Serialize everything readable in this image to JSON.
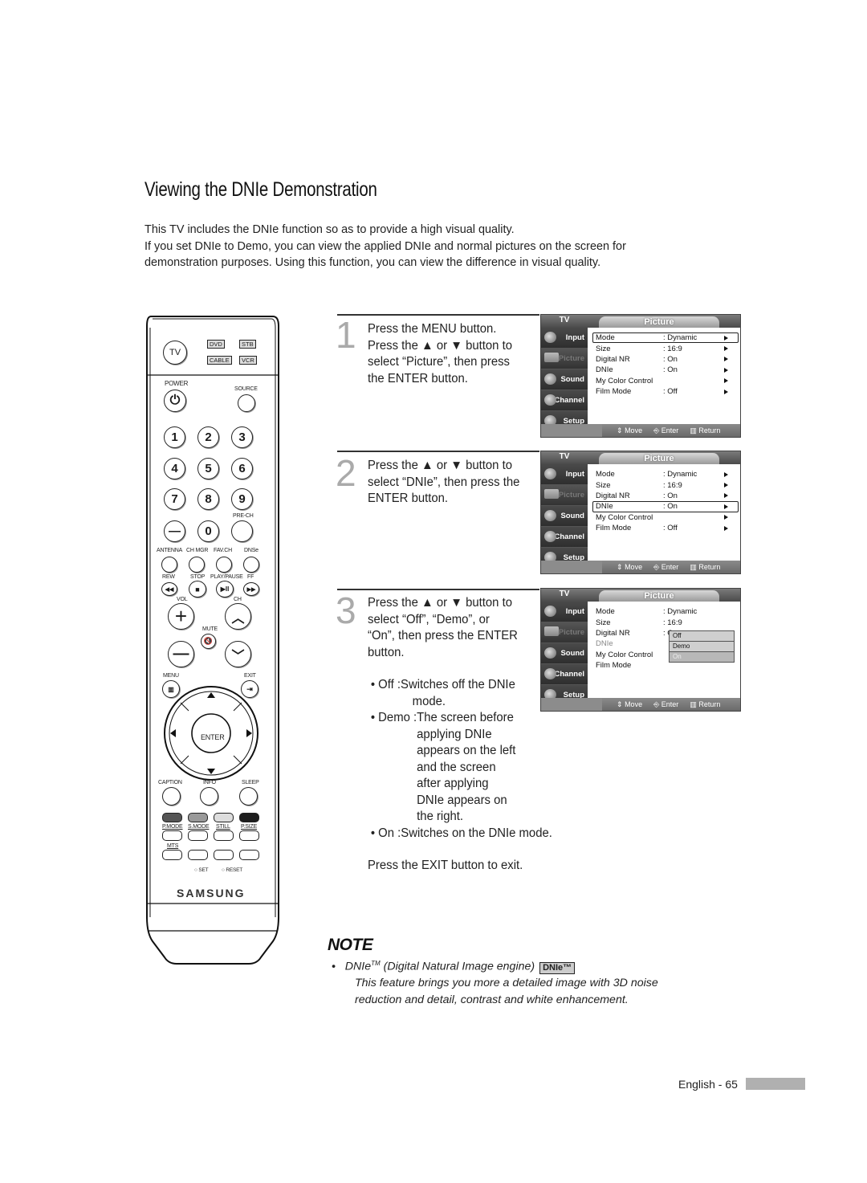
{
  "page": {
    "title": "Viewing the DNIe Demonstration",
    "intro": [
      "This TV includes the DNIe function so as to provide a high visual quality.",
      "If you set DNIe to Demo, you can view the applied DNIe and normal pictures on the screen for",
      "demonstration purposes. Using this function, you can view the difference in visual quality."
    ]
  },
  "steps": [
    {
      "number": "1",
      "lines": [
        "Press the MENU button.",
        "Press the ▲ or ▼ button to",
        "select “Picture”, then press",
        "the ENTER button."
      ]
    },
    {
      "number": "2",
      "lines": [
        "Press the ▲ or ▼ button to",
        "select “DNIe”, then press the",
        "ENTER button."
      ]
    },
    {
      "number": "3",
      "lines": [
        "Press the ▲ or ▼ button to",
        "select “Off”, “Demo”, or",
        "“On”, then press the ENTER",
        "button."
      ],
      "bullets": [
        {
          "label": "• Off : ",
          "lines": [
            "Switches off the DNIe",
            "mode."
          ]
        },
        {
          "label": "• Demo : ",
          "lines": [
            "The screen before",
            "applying DNIe",
            "appears on the left",
            "and the screen",
            "after applying",
            "DNIe appears on",
            "the right."
          ]
        },
        {
          "label": "• On : ",
          "lines": [
            "Switches on the DNIe mode."
          ]
        }
      ],
      "exit_text": "Press the EXIT button to exit."
    }
  ],
  "osd": {
    "tv_label": "TV",
    "tab_title": "Picture",
    "sidebar": [
      "Input",
      "Picture",
      "Sound",
      "Channel",
      "Setup"
    ],
    "rows": [
      {
        "key": "Mode",
        "value": ": Dynamic"
      },
      {
        "key": "Size",
        "value": ": 16:9"
      },
      {
        "key": "Digital NR",
        "value": ": On"
      },
      {
        "key": "DNIe",
        "value": ": On"
      },
      {
        "key": "My Color Control",
        "value": ""
      },
      {
        "key": "Film Mode",
        "value": ": Off"
      }
    ],
    "footer": {
      "move": "Move",
      "enter": "Enter",
      "return": "Return"
    },
    "dropdown": [
      "Off",
      "Demo",
      "On"
    ]
  },
  "remote": {
    "tv": "TV",
    "sources": [
      "DVD",
      "STB",
      "CABLE",
      "VCR"
    ],
    "power": "POWER",
    "source": "SOURCE",
    "digits": [
      "1",
      "2",
      "3",
      "4",
      "5",
      "6",
      "7",
      "8",
      "9",
      "—",
      "0"
    ],
    "prech": "PRE-CH",
    "row_labels": [
      "ANTENNA",
      "CH MGR",
      "FAV.CH",
      "DNSe"
    ],
    "transport_labels": [
      "REW",
      "STOP",
      "PLAY/PAUSE",
      "FF"
    ],
    "transport_glyphs": [
      "◀◀",
      "■",
      "▶II",
      "▶▶"
    ],
    "vol": "VOL",
    "ch": "CH",
    "mute": "MUTE",
    "menu": "MENU",
    "exit": "EXIT",
    "enter": "ENTER",
    "func_labels": [
      "CAPTION",
      "INFO",
      "SLEEP"
    ],
    "mode_labels": [
      "P.MODE",
      "S.MODE",
      "STILL",
      "P.SIZE"
    ],
    "color_keys": [
      "#555555",
      "#999999",
      "#dddddd",
      "#1e1e1e"
    ],
    "mts": "MTS",
    "set": "SET",
    "reset": "RESET",
    "brand": "SAMSUNG"
  },
  "note": {
    "title": "NOTE",
    "item_prefix": "DNIe",
    "item_tm": "TM",
    "item_rest": " (Digital Natural Image engine)",
    "badge": "DNIe™",
    "lines": [
      "This feature brings you more a detailed image with 3D noise",
      "reduction and detail, contrast and white enhancement."
    ]
  },
  "footer": {
    "text": "English - 65"
  }
}
